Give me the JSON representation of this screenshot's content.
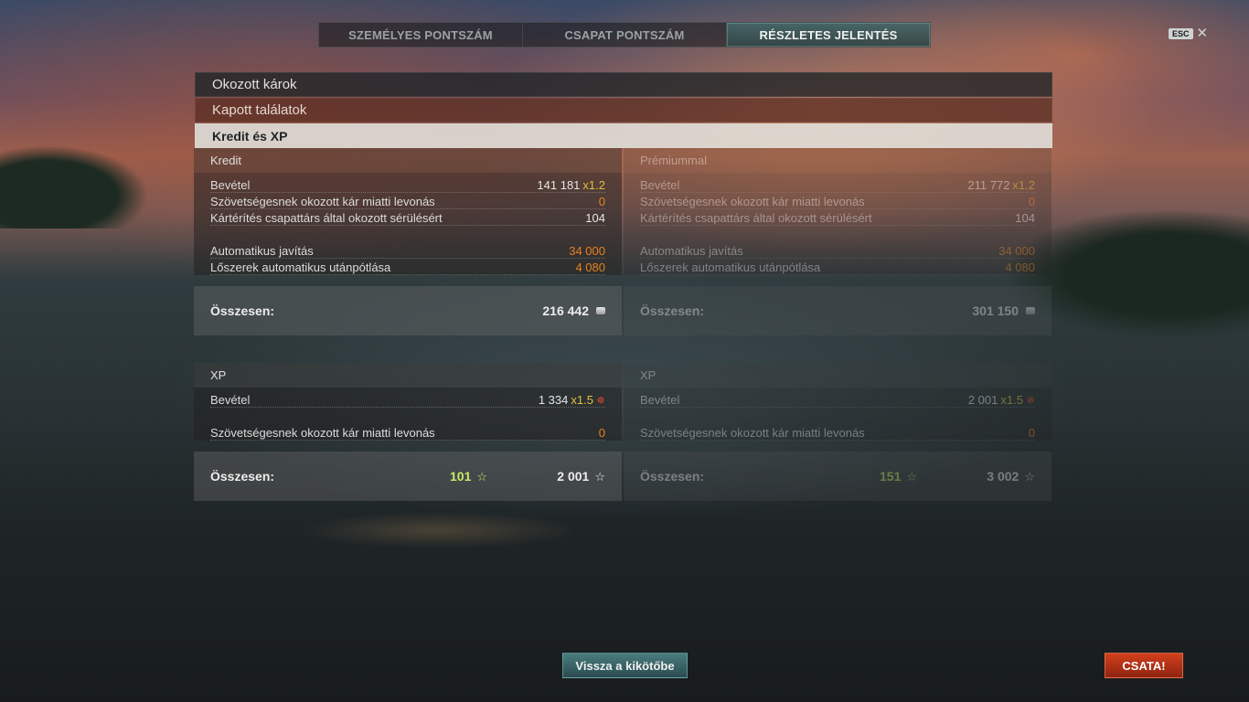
{
  "tabs": [
    {
      "label": "SZEMÉLYES PONTSZÁM"
    },
    {
      "label": "CSAPAT PONTSZÁM"
    },
    {
      "label": "RÉSZLETES JELENTÉS"
    }
  ],
  "esc": {
    "key": "ESC",
    "close": "✕"
  },
  "sections": {
    "damage_dealt": "Okozott károk",
    "hits_received": "Kapott találatok",
    "credits_xp": "Kredit és XP"
  },
  "credit": {
    "header": "Kredit",
    "rows": {
      "income": {
        "label": "Bevétel",
        "value": "141 181",
        "mult": "x1.2"
      },
      "ally_penalty": {
        "label": "Szövetségesnek okozott kár miatti levonás",
        "value": "0"
      },
      "compensation": {
        "label": "Kártérítés csapattárs által okozott sérülésért",
        "value": "104"
      },
      "auto_repair": {
        "label": "Automatikus javítás",
        "value": "34 000"
      },
      "auto_ammo": {
        "label": "Lőszerek automatikus utánpótlása",
        "value": "4 080"
      }
    },
    "total_label": "Összesen:",
    "total": "216 442"
  },
  "premium": {
    "header": "Prémiummal",
    "rows": {
      "income": {
        "label": "Bevétel",
        "value": "211 772",
        "mult": "x1.2"
      },
      "ally_penalty": {
        "label": "Szövetségesnek okozott kár miatti levonás",
        "value": "0"
      },
      "compensation": {
        "label": "Kártérítés csapattárs által okozott sérülésért",
        "value": "104"
      },
      "auto_repair": {
        "label": "Automatikus javítás",
        "value": "34 000"
      },
      "auto_ammo": {
        "label": "Lőszerek automatikus utánpótlása",
        "value": "4 080"
      }
    },
    "total_label": "Összesen:",
    "total": "301 150"
  },
  "xp": {
    "header": "XP",
    "income": {
      "label": "Bevétel",
      "value": "1 334",
      "mult": "x1.5"
    },
    "ally_penalty": {
      "label": "Szövetségesnek okozott kár miatti levonás",
      "value": "0"
    },
    "total_label": "Összesen:",
    "base_total": "101",
    "total": "2 001"
  },
  "xp_premium": {
    "header": "XP",
    "income": {
      "label": "Bevétel",
      "value": "2 001",
      "mult": "x1.5"
    },
    "ally_penalty": {
      "label": "Szövetségesnek okozott kár miatti levonás",
      "value": "0"
    },
    "total_label": "Összesen:",
    "base_total": "151",
    "total": "3 002"
  },
  "icons": {
    "coin": "credits-icon",
    "star": "☆",
    "xp_star": "✵"
  },
  "buttons": {
    "back": "Vissza a kikötőbe",
    "battle": "CSATA!"
  },
  "colors": {
    "accent_teal": "#4a7c7e",
    "battle_red": "#d2401c",
    "penalty_orange": "#e8821c",
    "multiplier_yellow": "#e0c040"
  }
}
